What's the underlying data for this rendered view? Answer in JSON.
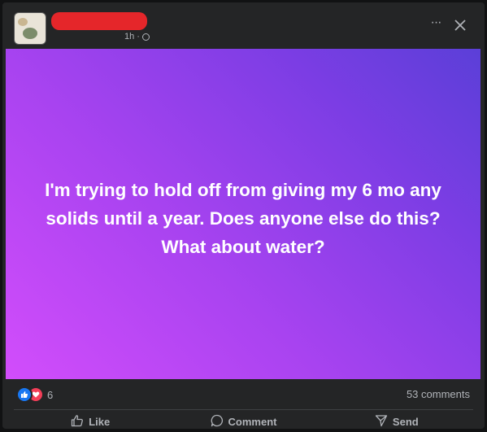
{
  "post": {
    "timestamp": "1h",
    "separator": "·",
    "text": "I'm trying to hold off from giving my 6 mo any solids until a year. Does anyone else do this? What about water?",
    "background_gradient": [
      "#d24dfb",
      "#a843f0",
      "#7c3de4",
      "#5b3fd8"
    ]
  },
  "header": {
    "more_label": "···",
    "icons": [
      "avatar",
      "globe-icon",
      "more-icon",
      "close-icon"
    ]
  },
  "stats": {
    "reaction_count": "6",
    "comments": "53 comments",
    "reaction_icons": [
      "like-reaction-icon",
      "love-reaction-icon"
    ]
  },
  "actions": {
    "like": "Like",
    "comment": "Comment",
    "send": "Send"
  },
  "colors": {
    "card": "#242526",
    "text_secondary": "#b0b3b8",
    "like_blue": "#1877f2",
    "love_red": "#f33e58",
    "redaction": "#e5262a"
  }
}
